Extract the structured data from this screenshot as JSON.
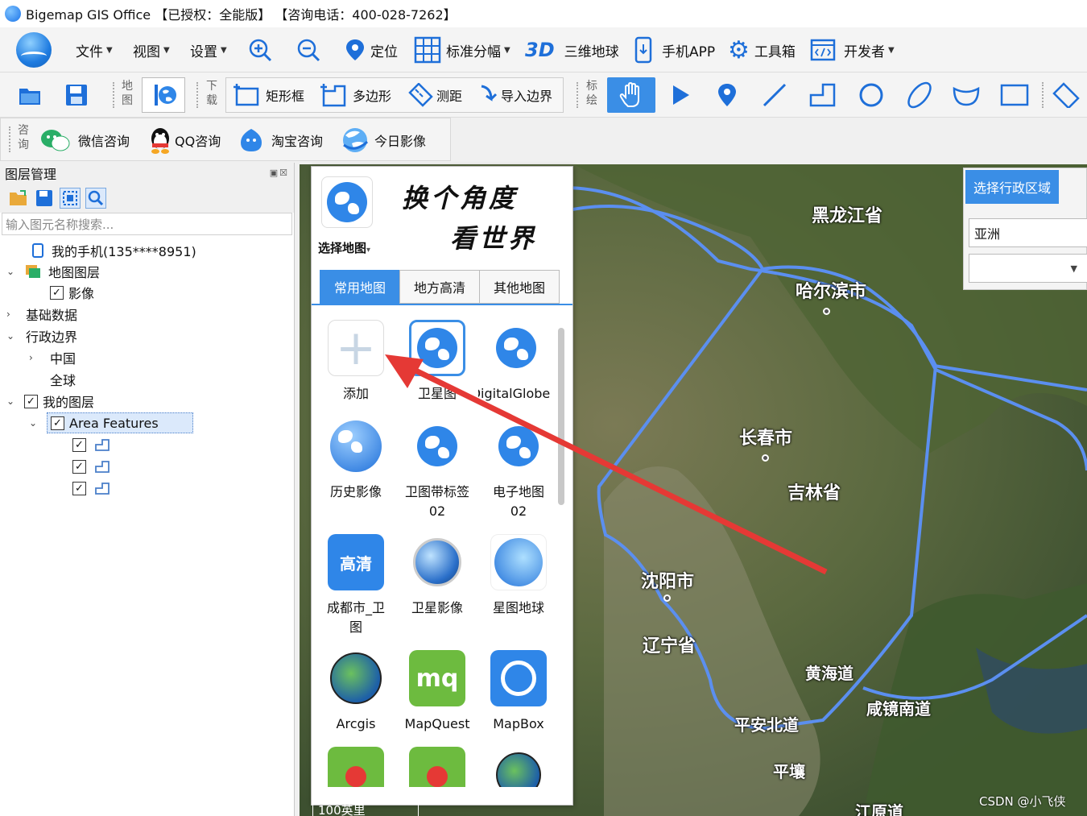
{
  "window": {
    "title": "Bigemap GIS Office 【已授权：全能版】 【咨询电话：400-028-7262】"
  },
  "menu": {
    "file": "文件",
    "view": "视图",
    "settings": "设置",
    "locate": "定位",
    "standard_sheet": "标准分幅",
    "globe_3d_prefix": "3D",
    "globe_3d": "三维地球",
    "mobile_app": "手机APP",
    "toolbox": "工具箱",
    "developer": "开发者"
  },
  "toolbar2": {
    "map_section": "地图",
    "download_section": "下载",
    "rectangle": "矩形框",
    "polygon": "多边形",
    "measure": "测距",
    "import_boundary": "导入边界",
    "draw_section": "标绘"
  },
  "toolbar3": {
    "consult_section": "咨询",
    "wechat": "微信咨询",
    "qq": "QQ咨询",
    "taobao": "淘宝咨询",
    "today_image": "今日影像"
  },
  "layer_panel": {
    "title": "图层管理",
    "search_placeholder": "输入图元名称搜索...",
    "tree": {
      "phone": "我的手机(135****8951)",
      "map_layers": "地图图层",
      "imagery": "影像",
      "base_data": "基础数据",
      "admin_boundary": "行政边界",
      "china": "中国",
      "global": "全球",
      "my_layers": "我的图层",
      "area_features": "Area Features"
    }
  },
  "map_selector": {
    "label": "选择地图",
    "slogan_line1": "换个角度",
    "slogan_line2": "看世界",
    "tabs": [
      "常用地图",
      "地方高清",
      "其他地图"
    ],
    "active_tab": "常用地图",
    "tiles": [
      {
        "label": "添加",
        "icon": "add-icon"
      },
      {
        "label": "卫星图",
        "icon": "globe-icon"
      },
      {
        "label": "DigitalGlobe",
        "icon": "globe-icon"
      },
      {
        "label": "历史影像",
        "icon": "history-globe-icon"
      },
      {
        "label": "卫图带标签02",
        "icon": "globe-icon"
      },
      {
        "label": "电子地图02",
        "icon": "globe-icon"
      },
      {
        "label": "成都市_卫图",
        "icon": "gaoqing-icon"
      },
      {
        "label": "卫星影像",
        "icon": "google-earth-icon"
      },
      {
        "label": "星图地球",
        "icon": "geovis-icon"
      },
      {
        "label": "Arcgis",
        "icon": "arcgis-icon"
      },
      {
        "label": "MapQuest",
        "icon": "mapquest-icon"
      },
      {
        "label": "MapBox",
        "icon": "mapbox-icon"
      }
    ]
  },
  "region_panel": {
    "tab": "选择行政区域",
    "continent": "亚洲",
    "country": ""
  },
  "map_labels": {
    "heilongjiang": "黑龙江省",
    "harbin": "哈尔滨市",
    "changchun": "长春市",
    "jilin": "吉林省",
    "shenyang": "沈阳市",
    "liaoning": "辽宁省",
    "huanghai": "黄海道",
    "pyongan": "平安北道",
    "pyongyang": "平壤",
    "hamgyong": "咸镜南道",
    "hwanghae": "江原道"
  },
  "scale": "100英里",
  "watermark": "CSDN @小飞侠",
  "colors": {
    "accent": "#3a8ee6",
    "boundary": "#5b8ff0",
    "arrow": "#e53935"
  }
}
